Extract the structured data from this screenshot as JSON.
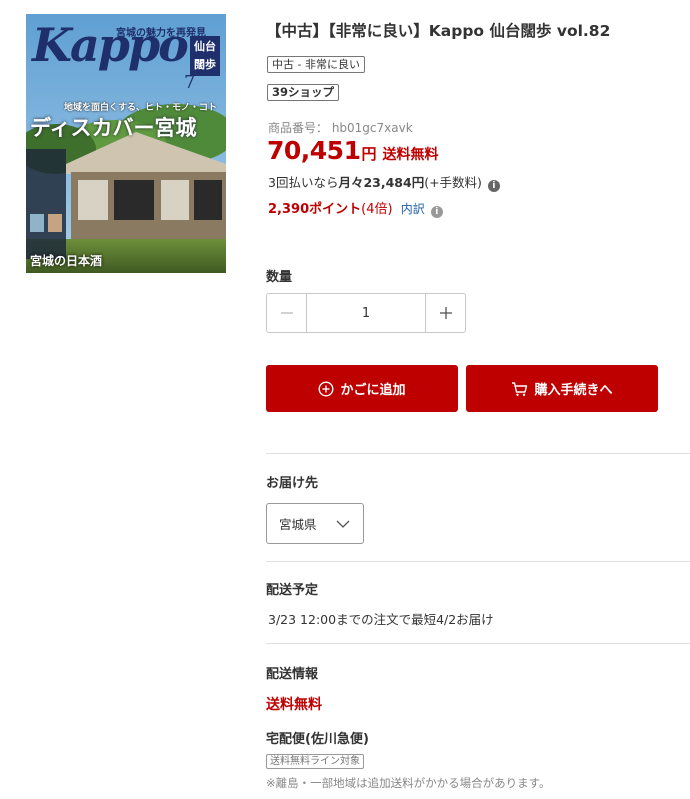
{
  "product": {
    "title": "【中古】【非常に良い】Kappo 仙台闊歩 vol.82",
    "condition_tag": "中古 - 非常に良い",
    "shop_tag": "39ショップ",
    "sku": "商品番号： hb01gc7xavk",
    "price": "70,451",
    "price_unit": "円",
    "shipping_free": "送料無料",
    "installment_prefix": "3回払いなら",
    "installment_amount": "月々23,484円",
    "installment_suffix": "(+手数料)",
    "points_amount": "2,390ポイント",
    "points_multiplier": "(4倍)",
    "points_breakdown": "内訳"
  },
  "cover": {
    "logo": "Kappo",
    "badge_line1": "仙台",
    "badge_line2": "闊歩",
    "issue": "7",
    "headline_small": "地域を面白くする、ヒト・モノ・コト",
    "headline_big": "ディスカバー宮城",
    "tagline": "宮城の魅力を再発見",
    "bottom_text": "宮城の日本酒"
  },
  "quantity": {
    "label": "数量",
    "value": "1",
    "minus": "−",
    "plus": "+"
  },
  "buttons": {
    "add_to_cart": "かごに追加",
    "checkout": "購入手続きへ"
  },
  "delivery": {
    "destination_label": "お届け先",
    "prefecture": "宮城県",
    "schedule_label": "配送予定",
    "schedule_text": "3/23 12:00までの注文で最短4/2お届け",
    "info_label": "配送情報",
    "info_free": "送料無料",
    "carrier": "宅配便(佐川急便)",
    "line_tag": "送料無料ライン対象",
    "note": "※離島・一部地域は追加送料がかかる場合があります。"
  },
  "colors": {
    "accent": "#bf0000",
    "link": "#1d5fa8"
  }
}
